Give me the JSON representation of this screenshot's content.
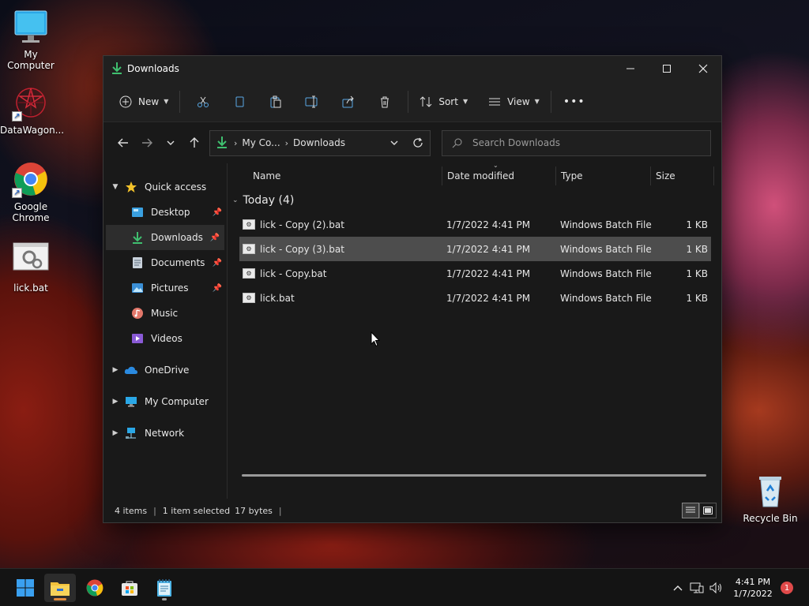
{
  "desktop": {
    "icons": [
      {
        "label": "My Computer",
        "icon": "monitor-icon"
      },
      {
        "label": "DataWagon...",
        "icon": "datawagon-icon"
      },
      {
        "label": "Google Chrome",
        "icon": "chrome-icon"
      },
      {
        "label": "lick.bat",
        "icon": "batch-file-icon"
      },
      {
        "label": "Recycle Bin",
        "icon": "recycle-bin-icon"
      }
    ]
  },
  "window": {
    "title": "Downloads",
    "controls": {
      "minimize": "—",
      "maximize": "☐",
      "close": "✕"
    }
  },
  "toolbar": {
    "new_label": "New",
    "sort_label": "Sort",
    "view_label": "View",
    "more": "•••"
  },
  "address": {
    "crumbs": [
      "My Co...",
      "Downloads"
    ],
    "search_placeholder": "Search Downloads"
  },
  "navpane": {
    "quick_access": "Quick access",
    "items": [
      {
        "label": "Desktop",
        "pinned": true
      },
      {
        "label": "Downloads",
        "pinned": true,
        "selected": true
      },
      {
        "label": "Documents",
        "pinned": true
      },
      {
        "label": "Pictures",
        "pinned": true
      },
      {
        "label": "Music",
        "pinned": false
      },
      {
        "label": "Videos",
        "pinned": false
      }
    ],
    "onedrive": "OneDrive",
    "mycomputer": "My Computer",
    "network": "Network"
  },
  "columns": {
    "name": "Name",
    "date": "Date modified",
    "type": "Type",
    "size": "Size"
  },
  "group": {
    "label": "Today (4)"
  },
  "files": [
    {
      "name": "lick - Copy (2).bat",
      "date": "1/7/2022 4:41 PM",
      "type": "Windows Batch File",
      "size": "1 KB",
      "selected": false
    },
    {
      "name": "lick - Copy (3).bat",
      "date": "1/7/2022 4:41 PM",
      "type": "Windows Batch File",
      "size": "1 KB",
      "selected": true
    },
    {
      "name": "lick - Copy.bat",
      "date": "1/7/2022 4:41 PM",
      "type": "Windows Batch File",
      "size": "1 KB",
      "selected": false
    },
    {
      "name": "lick.bat",
      "date": "1/7/2022 4:41 PM",
      "type": "Windows Batch File",
      "size": "1 KB",
      "selected": false
    }
  ],
  "status": {
    "items": "4 items",
    "selected": "1 item selected",
    "size": "17 bytes",
    "divider": "|"
  },
  "taskbar": {
    "time": "4:41 PM",
    "date": "1/7/2022",
    "notifications": "1",
    "overflow": "^"
  },
  "colors": {
    "accent": "#e08a3c",
    "selection": "#4d4d4d",
    "download": "#3fbf6f"
  }
}
